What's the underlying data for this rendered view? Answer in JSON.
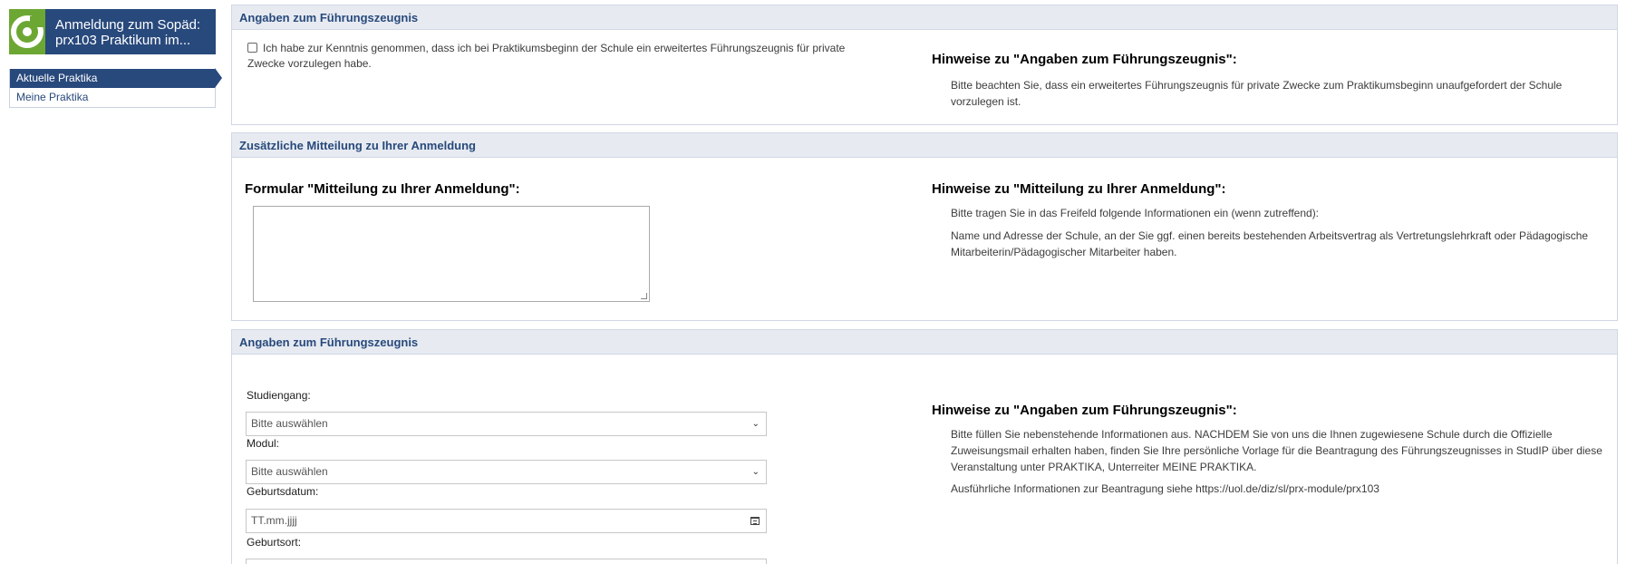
{
  "sidebar": {
    "title": "Anmeldung zum Sopäd: prx103 Praktikum im...",
    "logo_icon": "app-logo-icon",
    "items": [
      {
        "label": "Aktuelle Praktika",
        "active": true
      },
      {
        "label": "Meine Praktika",
        "active": false
      }
    ]
  },
  "panel1": {
    "header": "Angaben zum Führungszeugnis",
    "checkbox_label": "Ich habe zur Kenntnis genommen, dass ich bei Praktikumsbeginn der Schule ein erweitertes Führungszeugnis für private Zwecke vorzulegen habe.",
    "checked": false,
    "hint_title": "Hinweise zu \"Angaben zum Führungszeugnis\":",
    "hint_text": "Bitte beachten Sie, dass ein erweitertes Führungszeugnis für private Zwecke zum Praktikumsbeginn unaufgefordert der Schule vorzulegen ist."
  },
  "panel2": {
    "header": "Zusätzliche Mitteilung zu Ihrer Anmeldung",
    "form_title": "Formular \"Mitteilung zu Ihrer Anmeldung\":",
    "textarea_value": "",
    "hint_title": "Hinweise zu \"Mitteilung zu Ihrer Anmeldung\":",
    "hint_text_1": "Bitte tragen Sie in das Freifeld folgende Informationen ein (wenn zutreffend):",
    "hint_text_2": "Name und Adresse der Schule, an der Sie ggf. einen bereits bestehenden Arbeitsvertrag als Vertretungslehrkraft oder Pädagogische Mitarbeiterin/Pädagogischer Mitarbeiter haben."
  },
  "panel3": {
    "header": "Angaben zum Führungszeugnis",
    "studiengang_label": "Studiengang:",
    "studiengang_value": "Bitte auswählen",
    "modul_label": "Modul:",
    "modul_value": "Bitte auswählen",
    "geburtsdatum_label": "Geburtsdatum:",
    "geburtsdatum_placeholder": "TT.mm.jjjj",
    "geburtsort_label": "Geburtsort:",
    "geburtsort_value": "",
    "hint_title": "Hinweise zu \"Angaben zum Führungszeugnis\":",
    "hint_text_1": "Bitte füllen Sie nebenstehende Informationen aus. NACHDEM Sie von uns die Ihnen zugewiesene Schule durch die Offizielle Zuweisungsmail erhalten haben, finden Sie Ihre persönliche Vorlage für die Beantragung des Führungszeugnisses in StudIP über diese Veranstaltung unter PRAKTIKA, Unterreiter MEINE PRAKTIKA.",
    "hint_text_2": "Ausführliche Informationen zur Beantragung siehe https://uol.de/diz/sl/prx-module/prx103"
  },
  "colors": {
    "brand_blue": "#28497c",
    "logo_green": "#6da733",
    "header_bg": "#e7ebf1"
  }
}
